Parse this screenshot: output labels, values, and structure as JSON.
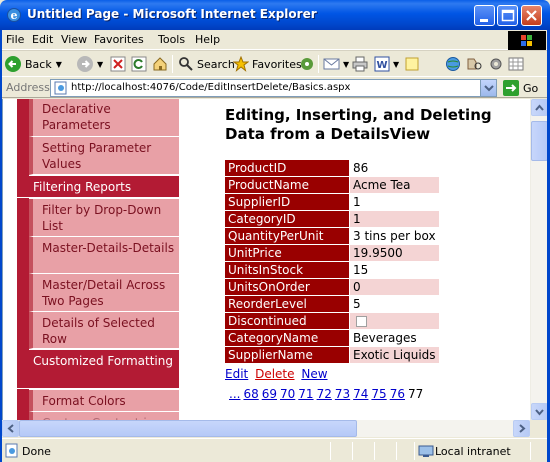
{
  "window": {
    "title": "Untitled Page - Microsoft Internet Explorer"
  },
  "menu": [
    "File",
    "Edit",
    "View",
    "Favorites",
    "Tools",
    "Help"
  ],
  "toolbar": {
    "back_label": "Back",
    "search_label": "Search",
    "favorites_label": "Favorites"
  },
  "address": {
    "label": "Address",
    "url": "http://localhost:4076/Code/EditInsertDelete/Basics.aspx",
    "go_label": "Go"
  },
  "sidebar": {
    "items": [
      {
        "label": "Declarative Parameters",
        "type": "item"
      },
      {
        "label": "Setting Parameter Values",
        "type": "item"
      },
      {
        "label": "Filtering Reports",
        "type": "section"
      },
      {
        "label": "Filter by Drop-Down List",
        "type": "item"
      },
      {
        "label": "Master-Details-Details",
        "type": "item"
      },
      {
        "label": "Master/Detail Across Two Pages",
        "type": "item"
      },
      {
        "label": "Details of Selected Row",
        "type": "item"
      },
      {
        "label": "Customized Formatting",
        "type": "section"
      },
      {
        "label": "Format Colors",
        "type": "item"
      },
      {
        "label": "Custom Content in a",
        "type": "item"
      }
    ]
  },
  "page": {
    "heading": "Editing, Inserting, and Deleting Data from a DetailsView",
    "details": [
      {
        "field": "ProductID",
        "value": "86"
      },
      {
        "field": "ProductName",
        "value": "Acme Tea"
      },
      {
        "field": "SupplierID",
        "value": "1"
      },
      {
        "field": "CategoryID",
        "value": "1"
      },
      {
        "field": "QuantityPerUnit",
        "value": "3 tins per box"
      },
      {
        "field": "UnitPrice",
        "value": "19.9500"
      },
      {
        "field": "UnitsInStock",
        "value": "15"
      },
      {
        "field": "UnitsOnOrder",
        "value": "0"
      },
      {
        "field": "ReorderLevel",
        "value": "5"
      },
      {
        "field": "Discontinued",
        "value": ""
      },
      {
        "field": "CategoryName",
        "value": "Beverages"
      },
      {
        "field": "SupplierName",
        "value": "Exotic Liquids"
      }
    ],
    "commands": {
      "edit": "Edit",
      "delete": "Delete",
      "new": "New"
    },
    "pager": {
      "links": [
        "...",
        "68",
        "69",
        "70",
        "71",
        "72",
        "73",
        "74",
        "75",
        "76"
      ],
      "current": "77"
    }
  },
  "status": {
    "text": "Done",
    "zone": "Local intranet"
  },
  "colors": {
    "nav_section": "#B31B34",
    "nav_item": "#E8A0A6",
    "field_header": "#990000",
    "alt_row": "#F4D4D4"
  }
}
